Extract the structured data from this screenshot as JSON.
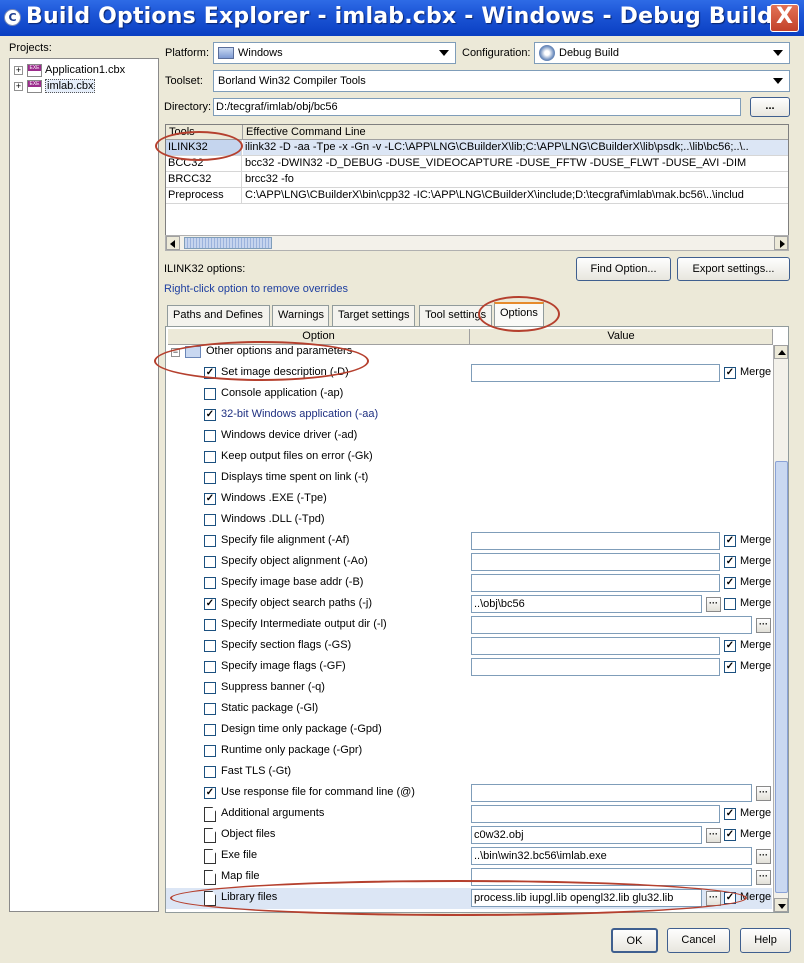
{
  "window": {
    "title": "Build Options Explorer - imlab.cbx - Windows - Debug Build",
    "icon": "app-icon",
    "close_label": "X"
  },
  "projects": {
    "label": "Projects:",
    "items": [
      {
        "label": "Application1.cbx",
        "expander": "+",
        "icon": "exe-project-icon"
      },
      {
        "label": "imlab.cbx",
        "expander": "+",
        "icon": "exe-project-icon",
        "selected": true
      }
    ]
  },
  "platform": {
    "label": "Platform:",
    "value": "Windows"
  },
  "configuration": {
    "label": "Configuration:",
    "value": "Debug Build"
  },
  "toolset": {
    "label": "Toolset:",
    "value": "Borland Win32 Compiler Tools"
  },
  "directory": {
    "label": "Directory:",
    "value": "D:/tecgraf/imlab/obj/bc56",
    "browse_label": "..."
  },
  "tools_table": {
    "headers": [
      "Tools",
      "Effective Command Line"
    ],
    "rows": [
      {
        "tool": "ILINK32",
        "cmd": "ilink32 -D -aa -Tpe -x -Gn -v -LC:\\APP\\LNG\\CBuilderX\\lib;C:\\APP\\LNG\\CBuilderX\\lib\\psdk;..\\lib\\bc56;..\\..",
        "selected": true
      },
      {
        "tool": "BCC32",
        "cmd": "bcc32 -DWIN32 -D_DEBUG -DUSE_VIDEOCAPTURE -DUSE_FFTW -DUSE_FLWT -DUSE_AVI -DIM"
      },
      {
        "tool": "BRCC32",
        "cmd": "brcc32 -fo"
      },
      {
        "tool": "Preprocess",
        "cmd": "C:\\APP\\LNG\\CBuilderX\\bin\\cpp32 -IC:\\APP\\LNG\\CBuilderX\\include;D:\\tecgraf\\imlab\\mak.bc56\\..\\includ"
      }
    ]
  },
  "options_header": {
    "title": "ILINK32 options:",
    "hint": "Right-click option to remove overrides",
    "find_button": "Find Option...",
    "export_button": "Export settings..."
  },
  "tabs": [
    {
      "label": "Paths and Defines"
    },
    {
      "label": "Warnings"
    },
    {
      "label": "Target settings"
    },
    {
      "label": "Tool settings"
    },
    {
      "label": "Options",
      "active": true
    }
  ],
  "grid": {
    "col_option": "Option",
    "col_value": "Value",
    "group_label": "Other options and parameters",
    "group_expander": "−",
    "merge_label": "Merge",
    "rows": [
      {
        "label": "Set image description (-D)",
        "checked": true,
        "has_value": true,
        "value": "",
        "merge": true,
        "merge_checked": true
      },
      {
        "label": "Console application (-ap)",
        "checked": false
      },
      {
        "label": "32-bit Windows application (-aa)",
        "checked": true,
        "highlight": true
      },
      {
        "label": "Windows device driver (-ad)",
        "checked": false
      },
      {
        "label": "Keep output files on error (-Gk)",
        "checked": false
      },
      {
        "label": "Displays time spent on link (-t)",
        "checked": false
      },
      {
        "label": "Windows .EXE (-Tpe)",
        "checked": true
      },
      {
        "label": "Windows .DLL (-Tpd)",
        "checked": false
      },
      {
        "label": "Specify file alignment (-Af)",
        "checked": false,
        "has_value": true,
        "value": "",
        "merge": true,
        "merge_checked": true
      },
      {
        "label": "Specify object alignment (-Ao)",
        "checked": false,
        "has_value": true,
        "value": "",
        "merge": true,
        "merge_checked": true
      },
      {
        "label": "Specify image base addr (-B)",
        "checked": false,
        "has_value": true,
        "value": "",
        "merge": true,
        "merge_checked": true
      },
      {
        "label": "Specify object search paths (-j)",
        "checked": true,
        "has_value": true,
        "value": "..\\obj\\bc56",
        "browse": true,
        "merge": true,
        "merge_checked": false
      },
      {
        "label": "Specify Intermediate output dir (-l)",
        "checked": false,
        "has_value": true,
        "value": "",
        "browse": true,
        "wide": true
      },
      {
        "label": "Specify section flags (-GS)",
        "checked": false,
        "has_value": true,
        "value": "",
        "merge": true,
        "merge_checked": true
      },
      {
        "label": "Specify image flags (-GF)",
        "checked": false,
        "has_value": true,
        "value": "",
        "merge": true,
        "merge_checked": true
      },
      {
        "label": "Suppress banner (-q)",
        "checked": false
      },
      {
        "label": "Static package (-Gl)",
        "checked": false
      },
      {
        "label": "Design time only package (-Gpd)",
        "checked": false
      },
      {
        "label": "Runtime only package (-Gpr)",
        "checked": false
      },
      {
        "label": "Fast TLS (-Gt)",
        "checked": false
      },
      {
        "label": "Use response file for command line (@)",
        "checked": true,
        "has_value": true,
        "value": "",
        "browse": true,
        "wide": true
      },
      {
        "label": "Additional arguments",
        "file": true,
        "has_value": true,
        "value": "",
        "merge": true,
        "merge_checked": true
      },
      {
        "label": "Object files",
        "file": true,
        "has_value": true,
        "value": "c0w32.obj",
        "browse": true,
        "merge": true,
        "merge_checked": true
      },
      {
        "label": "Exe file",
        "file": true,
        "has_value": true,
        "value": "..\\bin\\win32.bc56\\imlab.exe",
        "browse": true,
        "wide": true
      },
      {
        "label": "Map file",
        "file": true,
        "has_value": true,
        "value": "",
        "browse": true,
        "wide": true
      },
      {
        "label": "Library files",
        "file": true,
        "has_value": true,
        "value": "process.lib iupgl.lib opengl32.lib glu32.lib",
        "browse": true,
        "merge": true,
        "merge_checked": true,
        "selected": true
      }
    ]
  },
  "buttons": {
    "ok": "OK",
    "cancel": "Cancel",
    "help": "Help"
  },
  "colors": {
    "title_bar": "#1C55D6",
    "annotation": "#B5402E",
    "selection": "#DCE6F5",
    "link_hint": "#1E3FA0"
  }
}
